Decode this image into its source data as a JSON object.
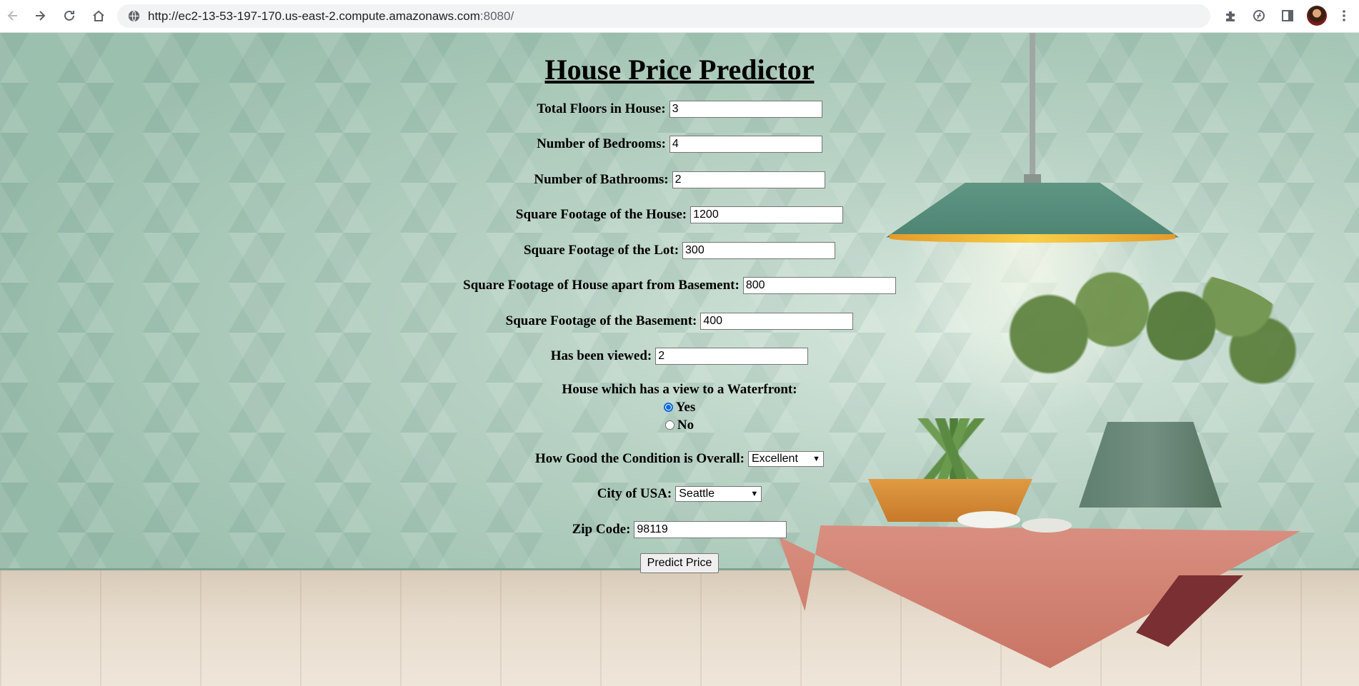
{
  "browser": {
    "url_main": "http://ec2-13-53-197-170.us-east-2.compute.amazonaws.com",
    "url_port": ":8080/",
    "icons": [
      "back-icon",
      "forward-icon",
      "reload-icon",
      "home-icon",
      "site-info-icon",
      "extensions-icon",
      "performance-icon",
      "side-panel-icon",
      "avatar",
      "more-menu-icon"
    ]
  },
  "form": {
    "title": "House Price Predictor",
    "fields": [
      {
        "label": "Total Floors in House:",
        "value": "3"
      },
      {
        "label": "Number of Bedrooms:",
        "value": "4"
      },
      {
        "label": "Number of Bathrooms:",
        "value": "2"
      },
      {
        "label": "Square Footage of the House:",
        "value": "1200"
      },
      {
        "label": "Square Footage of the Lot:",
        "value": "300"
      },
      {
        "label": "Square Footage of House apart from Basement:",
        "value": "800"
      },
      {
        "label": "Square Footage of the Basement:",
        "value": "400"
      },
      {
        "label": "Has been viewed:",
        "value": "2"
      }
    ],
    "waterfront": {
      "question": "House which has a view to a Waterfront:",
      "options": [
        {
          "label": "Yes",
          "selected": true
        },
        {
          "label": "No",
          "selected": false
        }
      ]
    },
    "condition": {
      "label": "How Good the Condition is Overall:",
      "selected": "Excellent"
    },
    "city": {
      "label": "City of USA:",
      "selected": "Seattle"
    },
    "zip": {
      "label": "Zip Code:",
      "value": "98119"
    },
    "submit_label": "Predict Price"
  },
  "colors": {
    "radio_accent": "#0b6ad8",
    "wall": "#9cc0ae",
    "table": "#d98f80"
  }
}
